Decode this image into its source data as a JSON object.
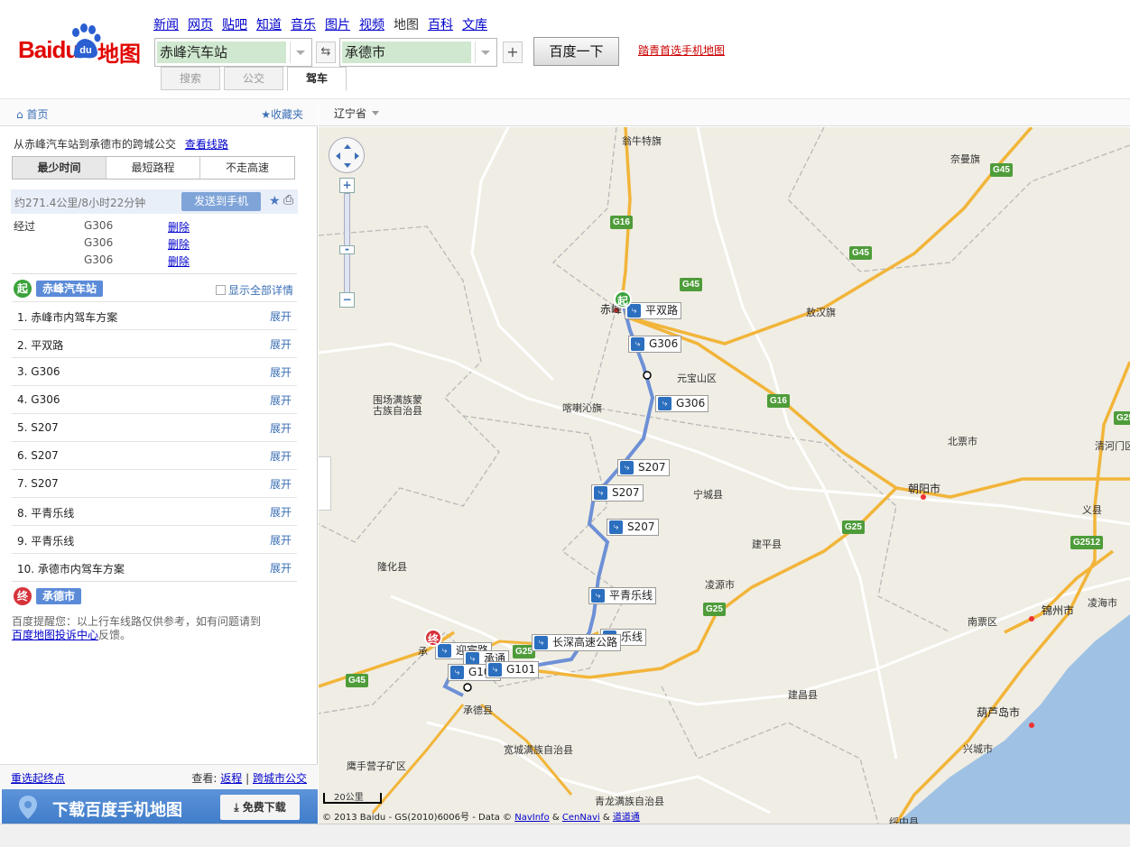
{
  "header": {
    "logo_text": "Baidu",
    "logo_suffix": "地图",
    "logo_paw": "du",
    "nav": [
      "新闻",
      "网页",
      "贴吧",
      "知道",
      "音乐",
      "图片",
      "视频",
      "地图",
      "百科",
      "文库"
    ],
    "nav_current": "地图",
    "from_value": "赤峰汽车站",
    "to_value": "承德市",
    "swap_icon": "swap-icon",
    "search_button": "百度一下",
    "mobile_link": "踏青首选手机地图",
    "modes": [
      "搜索",
      "公交",
      "驾车"
    ],
    "mode_active": "驾车"
  },
  "sidebar": {
    "home": "首页",
    "favorites": "收藏夹",
    "summary_text": "从赤峰汽车站到承德市的跨城公交",
    "summary_link": "查看线路",
    "tabs": [
      "最少时间",
      "最短路程",
      "不走高速"
    ],
    "tab_active": "最少时间",
    "distance": "约271.4公里/8小时22分钟",
    "send_button": "发送到手机",
    "via_label": "经过",
    "via": [
      {
        "road": "G306",
        "action": "删除"
      },
      {
        "road": "G306",
        "action": "删除"
      },
      {
        "road": "G306",
        "action": "删除"
      }
    ],
    "start_badge": "起",
    "start_name": "赤峰汽车站",
    "show_all": "显示全部详情",
    "steps": [
      {
        "label": "1. 赤峰市内驾车方案",
        "action": "展开"
      },
      {
        "label": "2. 平双路",
        "action": "展开"
      },
      {
        "label": "3. G306",
        "action": "展开"
      },
      {
        "label": "4. G306",
        "action": "展开"
      },
      {
        "label": "5. S207",
        "action": "展开"
      },
      {
        "label": "6. S207",
        "action": "展开"
      },
      {
        "label": "7. S207",
        "action": "展开"
      },
      {
        "label": "8. 平青乐线",
        "action": "展开"
      },
      {
        "label": "9. 平青乐线",
        "action": "展开"
      },
      {
        "label": "10. 承德市内驾车方案",
        "action": "展开"
      }
    ],
    "end_badge": "终",
    "end_name": "承德市",
    "tip_text": "百度提醒您：以上行车线路仅供参考，如有问题请到",
    "tip_link": "百度地图投诉中心",
    "tip_suffix": "反馈。",
    "reselect": "重选起终点",
    "view_label": "查看:",
    "return_link": "返程",
    "intercity_link": "跨城市公交",
    "promo_text": "下载百度手机地图",
    "promo_button": "免费下载"
  },
  "map": {
    "province": "辽宁省",
    "labels": {
      "wengniute": "翁牛特旗",
      "naiman": "奈曼旗",
      "aohan": "敖汉旗",
      "chifeng": "赤峰",
      "yuanbaoshan": "元宝山区",
      "harqin": "喀喇沁旗",
      "weichang1": "围场满族蒙",
      "weichang2": "古族自治县",
      "beipiao": "北票市",
      "qinghemen": "清河门区",
      "chaoyang": "朝阳市",
      "yixian": "义县",
      "ningcheng": "宁城县",
      "jianping": "建平县",
      "longhua": "隆化县",
      "lingyuan": "凌源市",
      "jinzhou": "锦州市",
      "linghai": "凌海市",
      "nanpiao": "南票区",
      "chengde_county": "承德县",
      "jianchang": "建昌县",
      "huludao": "葫芦岛市",
      "kuancheng": "宽城满族自治县",
      "yingshouyingzi": "鹰手营子矿区",
      "xingcheng": "兴城市",
      "qinglong": "青龙满族自治县",
      "suizhong": "绥中县",
      "chengde_label": "承"
    },
    "shields": {
      "g45a": "G45",
      "g16a": "G16",
      "g45b": "G45",
      "g45c": "G45",
      "g16b": "G16",
      "g25a": "G25",
      "g25b": "G25",
      "g2512": "G2512",
      "g25c": "G25",
      "g45d": "G45",
      "g25d": "G25"
    },
    "route_labels": {
      "pingshuang": "平双路",
      "g306a": "G306",
      "g306b": "G306",
      "s207a": "S207",
      "s207b": "S207",
      "s207c": "S207",
      "pingqingle_a": "平青乐线",
      "pingqingle_b": "乐线",
      "changshen": "长深高速公路",
      "yingbin": "迎宾路",
      "g101a": "G101",
      "g101b": "G101",
      "chengtong": "承通"
    },
    "start_marker": "起",
    "end_marker": "终",
    "scale": "20公里",
    "copyright_prefix": "© 2013 Baidu - GS(2010)6006号 - Data ©",
    "copyright_navinfo": "NavInfo",
    "copyright_amp": "&",
    "copyright_cennavi": "CenNavi",
    "copyright_daodaotong": "道道通",
    "colors": {
      "route": "#6d90d6",
      "highway": "#f2b53a",
      "road": "#ffffff",
      "sea": "#9fc2e4",
      "land": "#f0ede4"
    }
  }
}
